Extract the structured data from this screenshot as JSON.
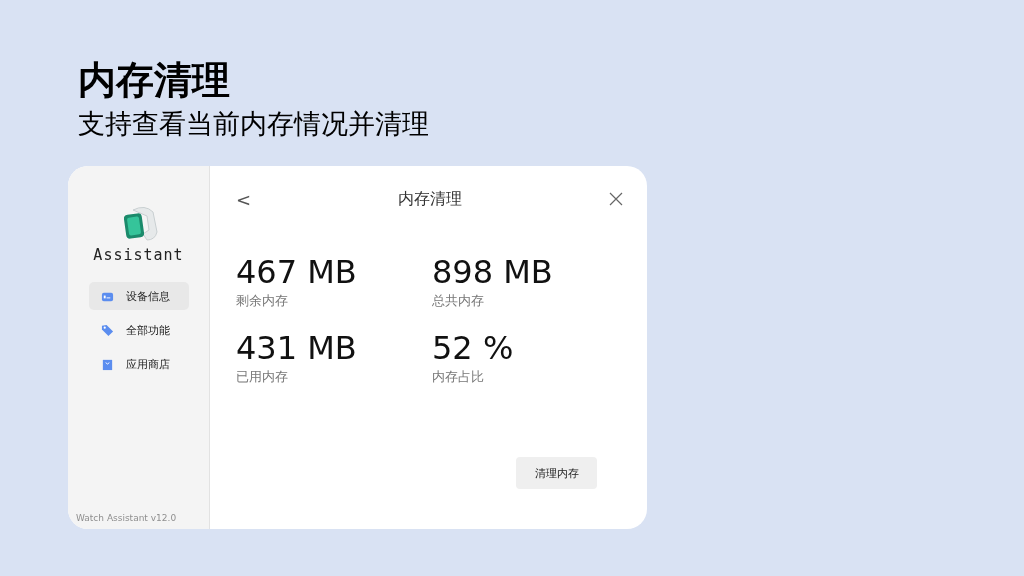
{
  "heading": {
    "title": "内存清理",
    "subtitle": "支持查看当前内存情况并清理"
  },
  "sidebar": {
    "brand": "Assistant",
    "items": [
      {
        "label": "设备信息",
        "kind": "device",
        "selected": true
      },
      {
        "label": "全部功能",
        "kind": "tag",
        "selected": false
      },
      {
        "label": "应用商店",
        "kind": "store",
        "selected": false
      }
    ],
    "version": "Watch Assistant v12.0"
  },
  "panel": {
    "back": "<",
    "title": "内存清理",
    "stats": [
      {
        "value": "467 MB",
        "label": "剩余内存"
      },
      {
        "value": "898 MB",
        "label": "总共内存"
      },
      {
        "value": "431 MB",
        "label": "已用内存"
      },
      {
        "value": "52 %",
        "label": "内存占比"
      }
    ],
    "button": "清理内存"
  }
}
